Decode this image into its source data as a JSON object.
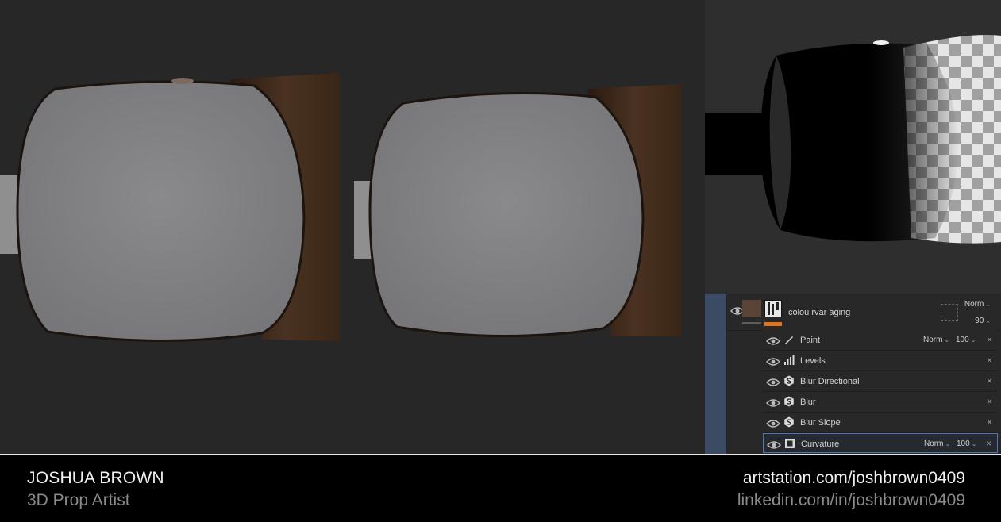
{
  "footer": {
    "name": "JOSHUA BROWN",
    "role": "3D Prop Artist",
    "artstation": "artstation.com/joshbrown0409",
    "linkedin": "linkedin.com/in/joshbrown0409"
  },
  "layers_panel": {
    "group": {
      "name": "colou rvar aging",
      "blend": "Norm",
      "opacity": "90",
      "swatch_color": "#5a4438",
      "accent_color": "#e0731c"
    },
    "effects": [
      {
        "label": "Paint",
        "icon": "brush-icon",
        "blend": "Norm",
        "opacity": "100",
        "selected": false
      },
      {
        "label": "Levels",
        "icon": "levels-icon",
        "blend": "",
        "opacity": "",
        "selected": false
      },
      {
        "label": "Blur Directional",
        "icon": "filter-icon",
        "blend": "",
        "opacity": "",
        "selected": false
      },
      {
        "label": "Blur",
        "icon": "filter-icon",
        "blend": "",
        "opacity": "",
        "selected": false
      },
      {
        "label": "Blur Slope",
        "icon": "filter-icon",
        "blend": "",
        "opacity": "",
        "selected": false
      },
      {
        "label": "Curvature",
        "icon": "generator-icon",
        "blend": "Norm",
        "opacity": "100",
        "selected": true
      }
    ]
  }
}
